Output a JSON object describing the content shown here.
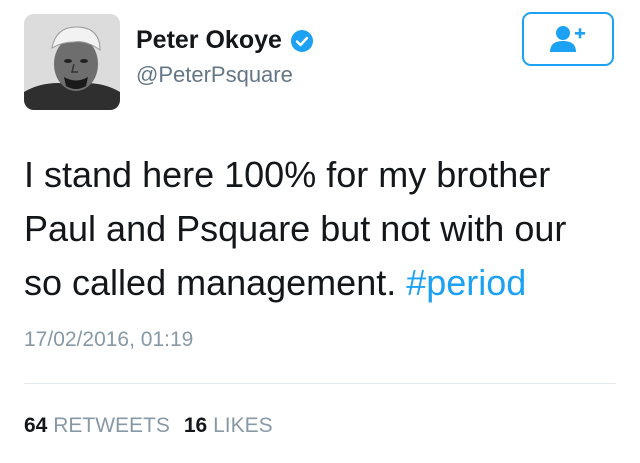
{
  "profile": {
    "display_name": "Peter Okoye",
    "handle": "@PeterPsquare",
    "verified": true
  },
  "follow_button": {
    "icon": "add-user-icon"
  },
  "tweet": {
    "text_lines": [
      "I stand here 100% for my brother",
      "Paul and Psquare but not with our",
      "so called management. "
    ],
    "hashtag": "#period",
    "timestamp": "17/02/2016, 01:19"
  },
  "stats": {
    "retweets_count": "64",
    "retweets_label": "RETWEETS",
    "likes_count": "16",
    "likes_label": "LIKES"
  },
  "colors": {
    "accent": "#1da1f2",
    "text": "#14171a",
    "secondary": "#657786",
    "muted": "#8899a6"
  }
}
